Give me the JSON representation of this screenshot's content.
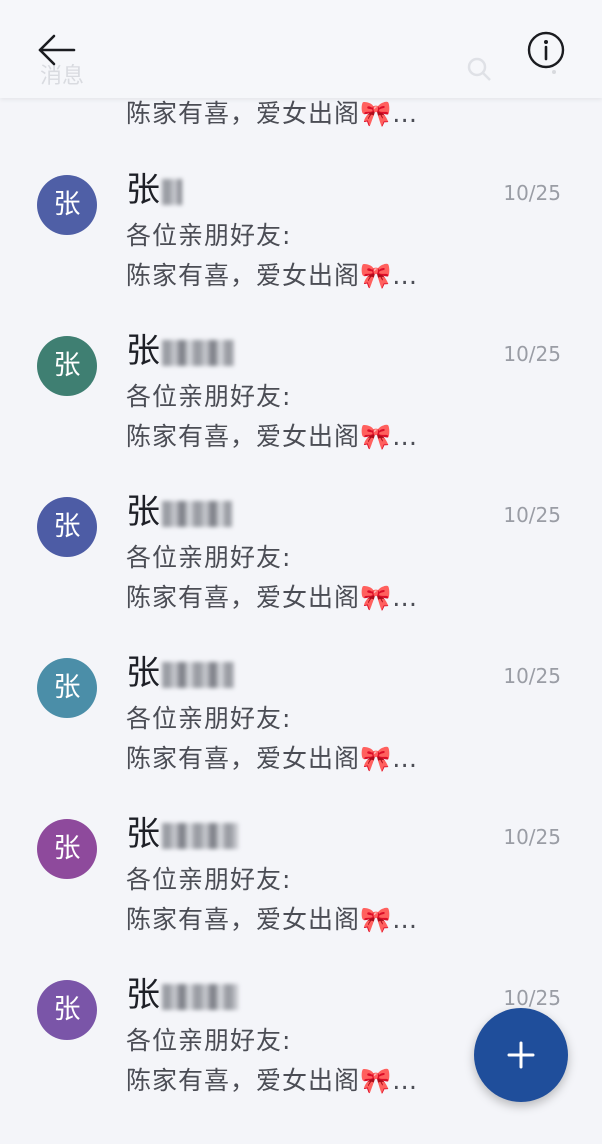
{
  "header": {
    "ghost_title": "消息",
    "back_icon": "arrow-left-icon",
    "info_icon": "info-circle-icon"
  },
  "partial_preview": {
    "text": "陈家有喜，爱女出阁",
    "emoji": "🎀",
    "ellipsis": "…"
  },
  "conversations": [
    {
      "avatar_letter": "张",
      "avatar_color": "#4f5fa6",
      "sender": "张",
      "date": "10/25",
      "line1": "各位亲朋好友:",
      "line2": "陈家有喜，爱女出阁",
      "emoji": "🎀",
      "ellipsis": "…"
    },
    {
      "avatar_letter": "张",
      "avatar_color": "#3f7f72",
      "sender": "张",
      "date": "10/25",
      "line1": "各位亲朋好友:",
      "line2": "陈家有喜，爱女出阁",
      "emoji": "🎀",
      "ellipsis": "…"
    },
    {
      "avatar_letter": "张",
      "avatar_color": "#4d5ca5",
      "sender": "张",
      "date": "10/25",
      "line1": "各位亲朋好友:",
      "line2": "陈家有喜，爱女出阁",
      "emoji": "🎀",
      "ellipsis": "…"
    },
    {
      "avatar_letter": "张",
      "avatar_color": "#4b8ea8",
      "sender": "张",
      "date": "10/25",
      "line1": "各位亲朋好友:",
      "line2": "陈家有喜，爱女出阁",
      "emoji": "🎀",
      "ellipsis": "…"
    },
    {
      "avatar_letter": "张",
      "avatar_color": "#8e4a9c",
      "sender": "张",
      "date": "10/25",
      "line1": "各位亲朋好友:",
      "line2": "陈家有喜，爱女出阁",
      "emoji": "🎀",
      "ellipsis": "…"
    },
    {
      "avatar_letter": "张",
      "avatar_color": "#7a55a8",
      "sender": "张",
      "date": "10/25",
      "line1": "各位亲朋好友:",
      "line2": "陈家有喜，爱女出阁",
      "emoji": "🎀",
      "ellipsis": "…"
    }
  ],
  "fab": {
    "icon": "plus-icon"
  }
}
